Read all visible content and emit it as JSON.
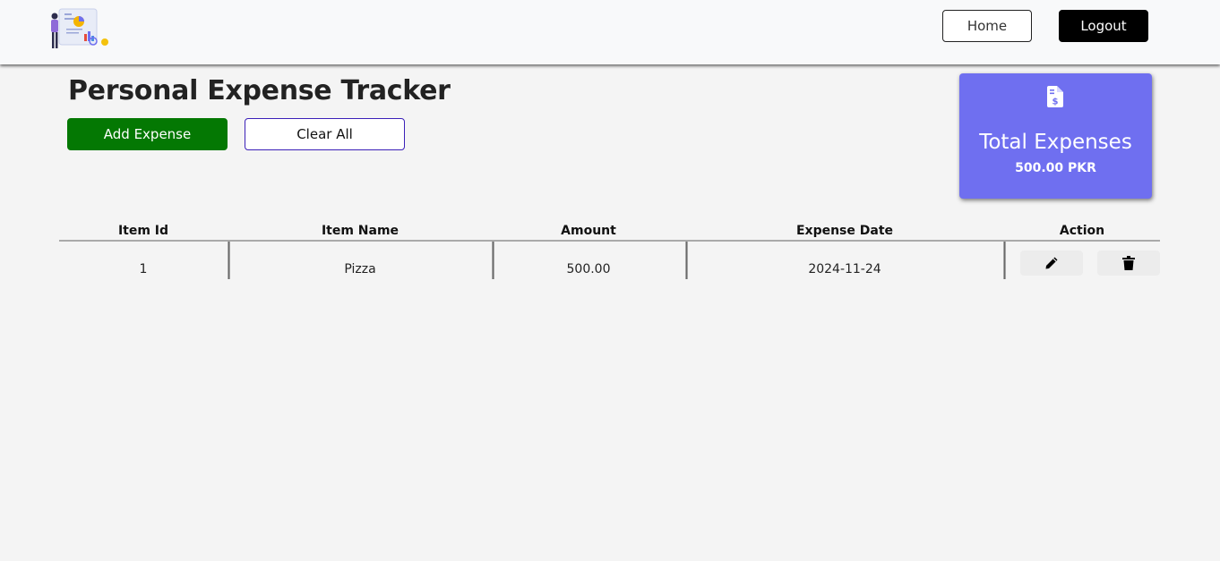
{
  "navbar": {
    "home_label": "Home",
    "logout_label": "Logout"
  },
  "page": {
    "title": "Personal Expense Tracker",
    "add_label": "Add Expense",
    "clear_label": "Clear All"
  },
  "summary": {
    "label": "Total Expenses",
    "value": "500.00 PKR",
    "card_color": "#6f6ff0"
  },
  "table": {
    "headers": [
      "Item Id",
      "Item Name",
      "Amount",
      "Expense Date",
      "Action"
    ],
    "rows": [
      {
        "id": "1",
        "name": "Pizza",
        "amount": "500.00",
        "date": "2024-11-24"
      }
    ]
  },
  "icons": {
    "logo": "expense-illustration-logo",
    "summary": "invoice-dollar-icon",
    "edit": "pencil-icon",
    "delete": "trash-icon"
  },
  "colors": {
    "add_button": "#047803",
    "clear_border": "#3b20b8",
    "logout_button": "#000000"
  }
}
